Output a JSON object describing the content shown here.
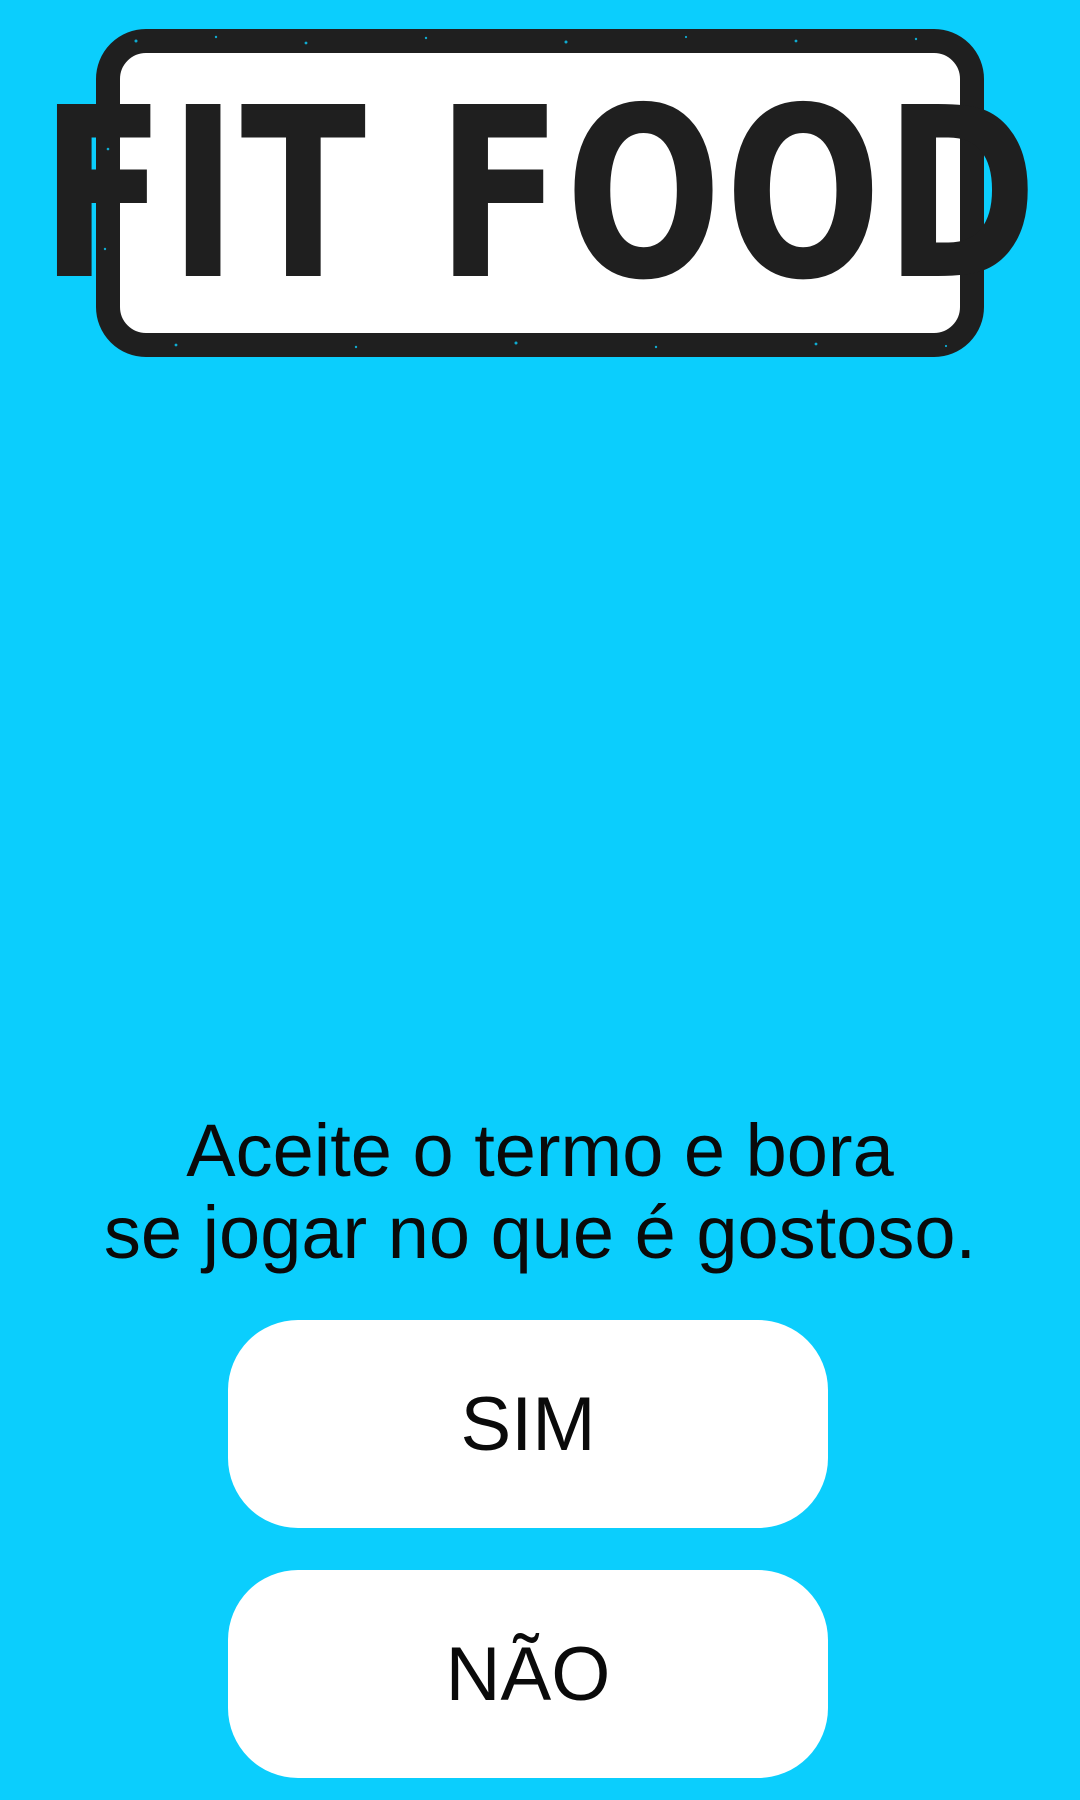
{
  "logo": {
    "text": "FIT FOOD"
  },
  "terms": {
    "line1": "Aceite o termo e bora",
    "line2": "se jogar no que é gostoso."
  },
  "buttons": {
    "yes_label": "SIM",
    "no_label": "NÃO"
  },
  "colors": {
    "background": "#0bcefd",
    "logo_border": "#1f1f1f",
    "button": "#ffffff",
    "text": "#0a0a0a"
  }
}
